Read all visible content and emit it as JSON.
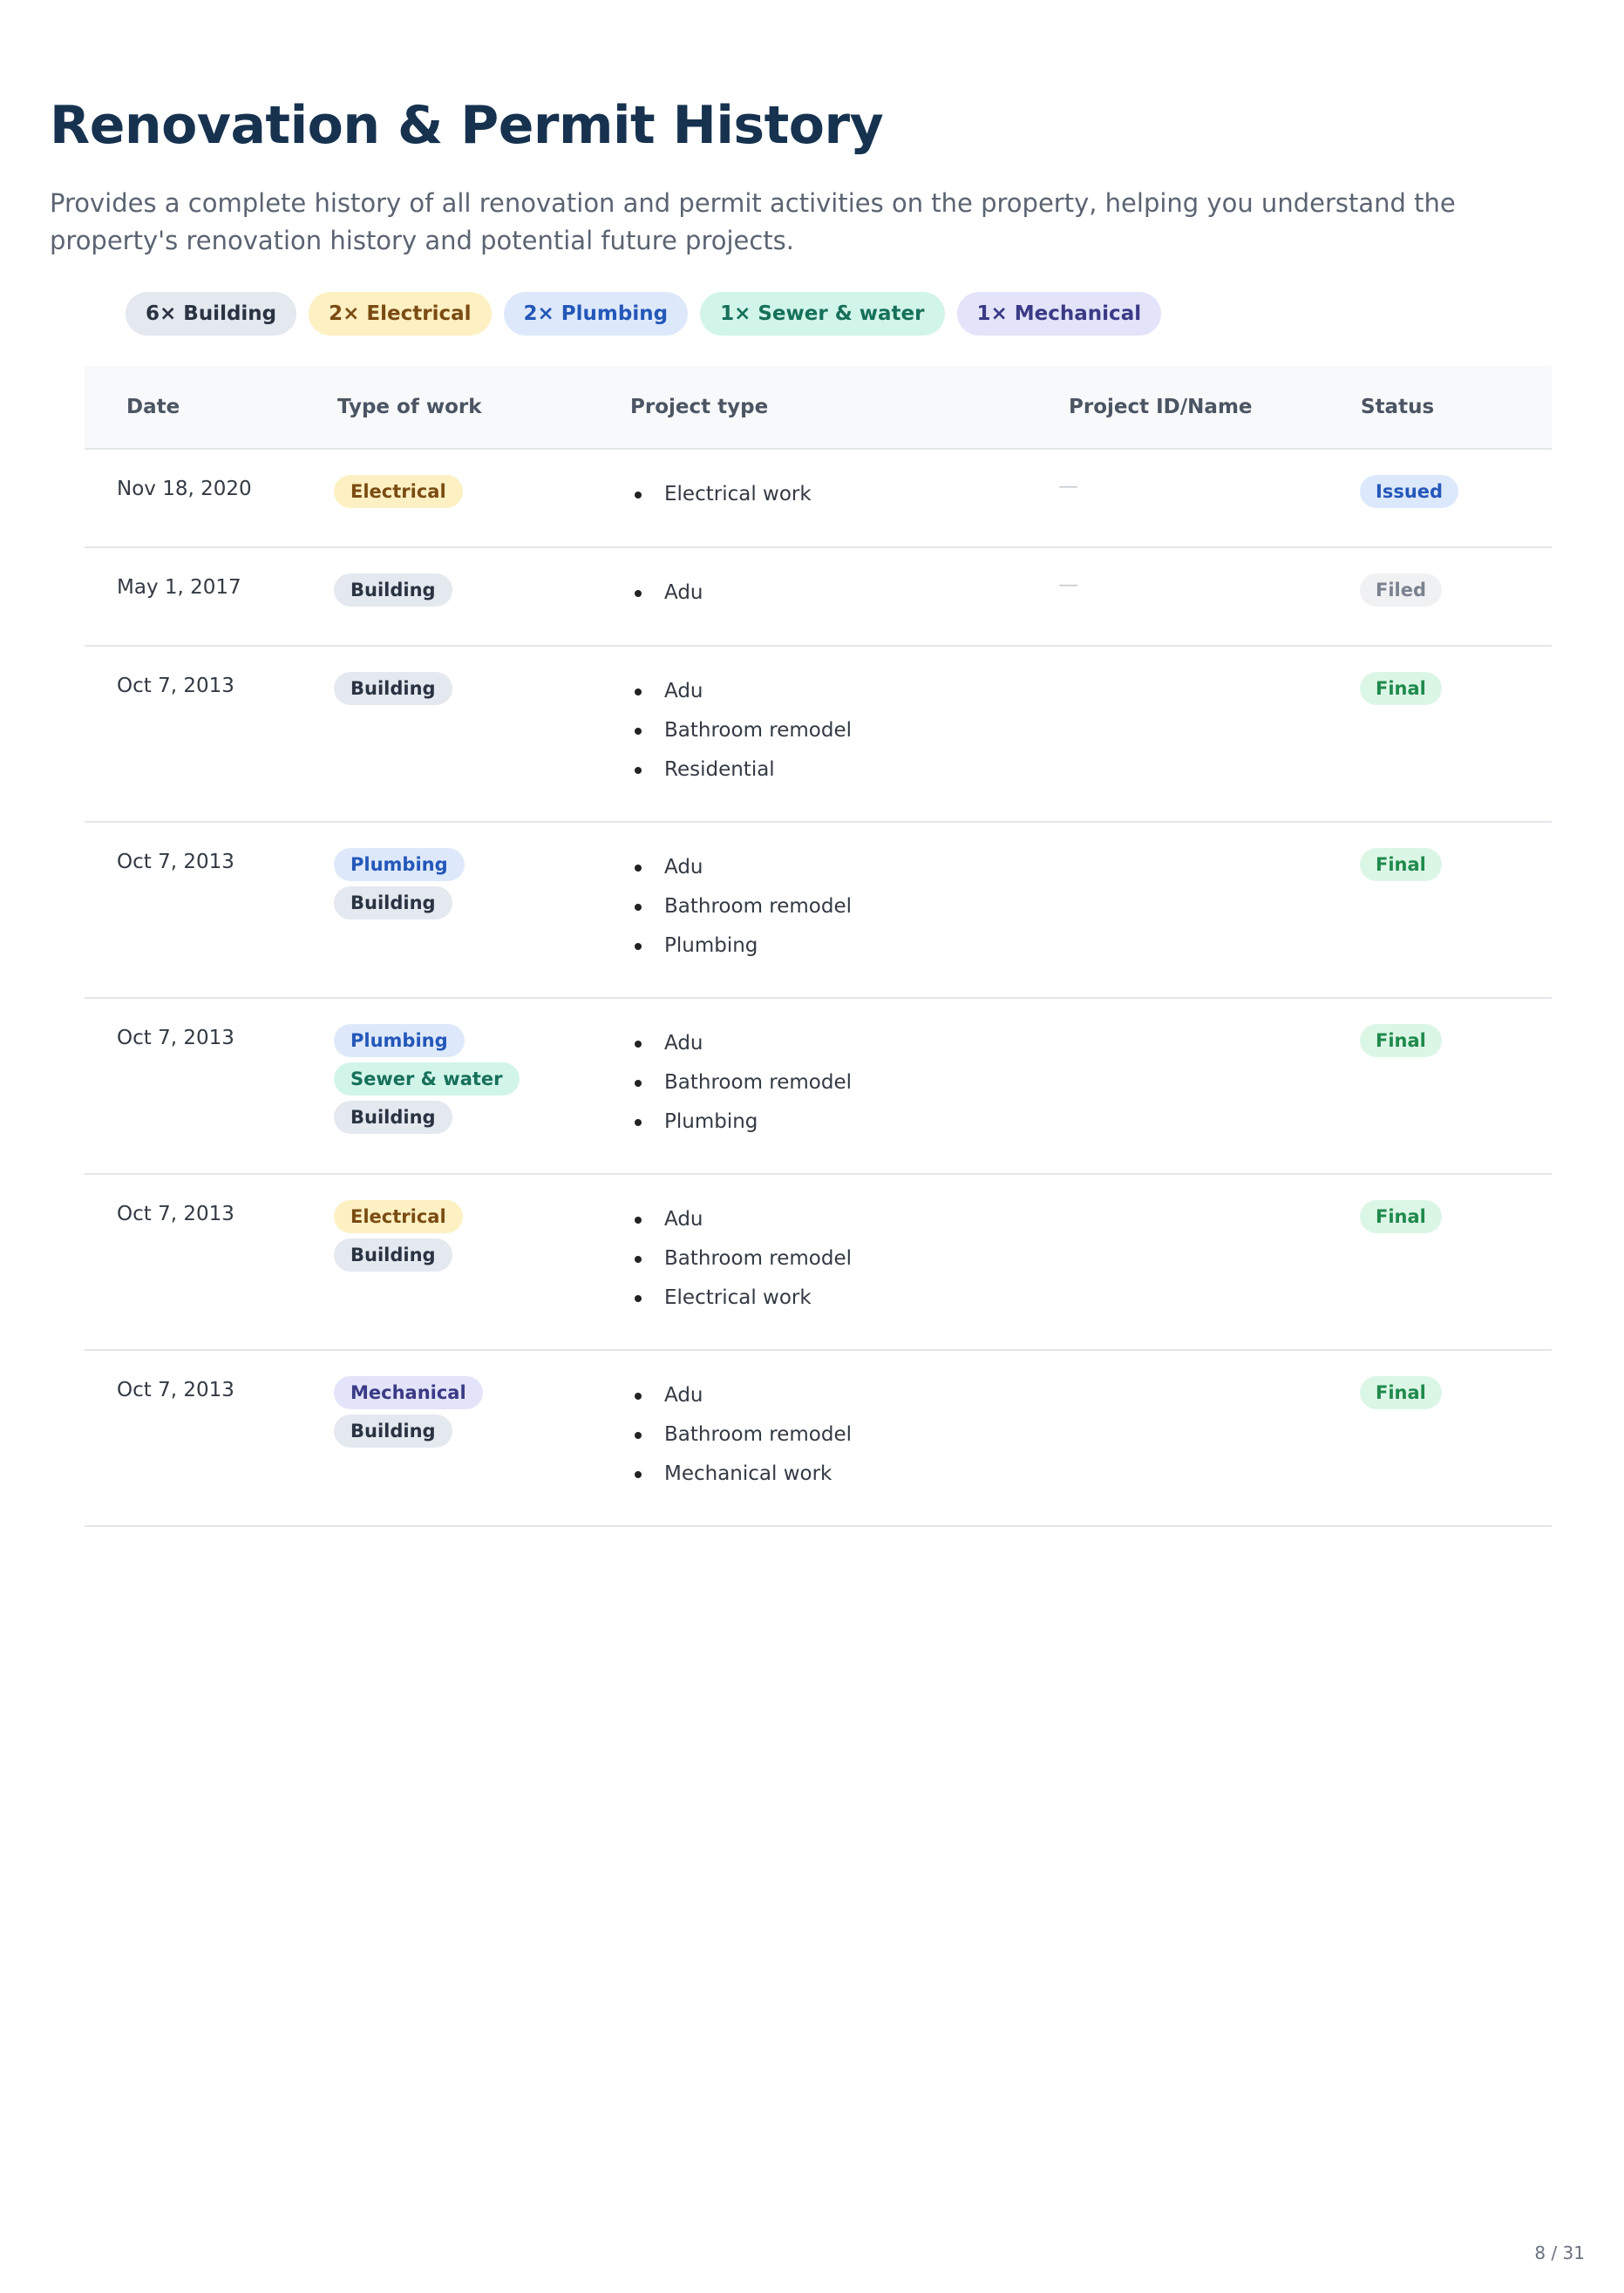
{
  "page": {
    "title": "Renovation & Permit History",
    "description": "Provides a complete history of all renovation and permit activities on the property, helping you understand the property's renovation history and potential future projects.",
    "page_number": "8 / 31"
  },
  "colors": {
    "title": "#16324f",
    "building": {
      "bg": "#e4e8ef",
      "fg": "#2a3342"
    },
    "electrical": {
      "bg": "#fdf0c2",
      "fg": "#7a4b12"
    },
    "plumbing": {
      "bg": "#dde9fb",
      "fg": "#2457b8"
    },
    "sewer": {
      "bg": "#d2f5ea",
      "fg": "#17705a"
    },
    "mechanical": {
      "bg": "#e3e4fa",
      "fg": "#3a3a86"
    },
    "issued": {
      "bg": "#dce8fb",
      "fg": "#2457b8"
    },
    "filed": {
      "bg": "#f0f1f3",
      "fg": "#7a8290"
    },
    "final": {
      "bg": "#dcf6e6",
      "fg": "#1f8a4c"
    }
  },
  "summary": [
    {
      "label": "6× Building",
      "kind": "building"
    },
    {
      "label": "2× Electrical",
      "kind": "electrical"
    },
    {
      "label": "2× Plumbing",
      "kind": "plumbing"
    },
    {
      "label": "1× Sewer & water",
      "kind": "sewer"
    },
    {
      "label": "1× Mechanical",
      "kind": "mechanical"
    }
  ],
  "table": {
    "headers": {
      "date": "Date",
      "type": "Type of work",
      "project": "Project type",
      "id": "Project ID/Name",
      "status": "Status"
    },
    "rows": [
      {
        "date": "Nov 18, 2020",
        "types": [
          {
            "label": "Electrical",
            "kind": "electrical"
          }
        ],
        "projects": [
          "Electrical work"
        ],
        "id": "—",
        "status": {
          "label": "Issued",
          "kind": "issued"
        }
      },
      {
        "date": "May 1, 2017",
        "types": [
          {
            "label": "Building",
            "kind": "building"
          }
        ],
        "projects": [
          "Adu"
        ],
        "id": "—",
        "status": {
          "label": "Filed",
          "kind": "filed"
        }
      },
      {
        "date": "Oct 7, 2013",
        "types": [
          {
            "label": "Building",
            "kind": "building"
          }
        ],
        "projects": [
          "Adu",
          "Bathroom remodel",
          "Residential"
        ],
        "id": "",
        "status": {
          "label": "Final",
          "kind": "final"
        }
      },
      {
        "date": "Oct 7, 2013",
        "types": [
          {
            "label": "Plumbing",
            "kind": "plumbing"
          },
          {
            "label": "Building",
            "kind": "building"
          }
        ],
        "projects": [
          "Adu",
          "Bathroom remodel",
          "Plumbing"
        ],
        "id": "",
        "status": {
          "label": "Final",
          "kind": "final"
        }
      },
      {
        "date": "Oct 7, 2013",
        "types": [
          {
            "label": "Plumbing",
            "kind": "plumbing"
          },
          {
            "label": "Sewer & water",
            "kind": "sewer"
          },
          {
            "label": "Building",
            "kind": "building"
          }
        ],
        "projects": [
          "Adu",
          "Bathroom remodel",
          "Plumbing"
        ],
        "id": "",
        "status": {
          "label": "Final",
          "kind": "final"
        }
      },
      {
        "date": "Oct 7, 2013",
        "types": [
          {
            "label": "Electrical",
            "kind": "electrical"
          },
          {
            "label": "Building",
            "kind": "building"
          }
        ],
        "projects": [
          "Adu",
          "Bathroom remodel",
          "Electrical work"
        ],
        "id": "",
        "status": {
          "label": "Final",
          "kind": "final"
        }
      },
      {
        "date": "Oct 7, 2013",
        "types": [
          {
            "label": "Mechanical",
            "kind": "mechanical"
          },
          {
            "label": "Building",
            "kind": "building"
          }
        ],
        "projects": [
          "Adu",
          "Bathroom remodel",
          "Mechanical work"
        ],
        "id": "",
        "status": {
          "label": "Final",
          "kind": "final"
        }
      }
    ]
  }
}
